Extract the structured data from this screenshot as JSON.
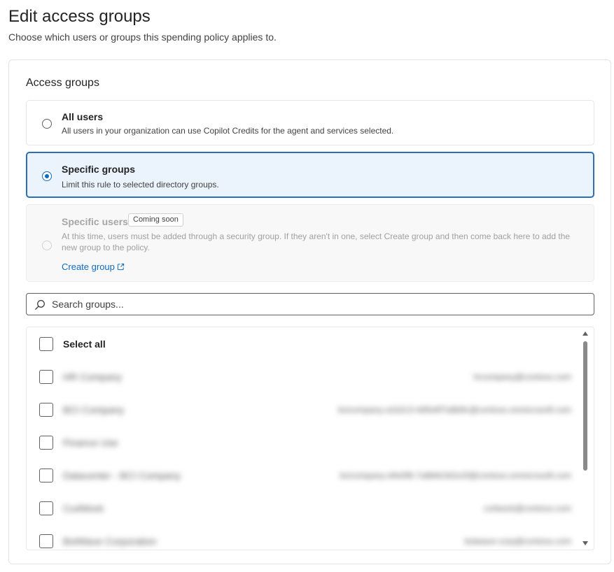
{
  "header": {
    "title": "Edit access groups",
    "subtitle": "Choose which users or groups this spending policy applies to."
  },
  "section": {
    "title": "Access groups"
  },
  "options": {
    "all_users": {
      "title": "All users",
      "description": "All users in your organization can use Copilot Credits for the agent and services selected.",
      "selected": false
    },
    "specific_groups": {
      "title": "Specific groups",
      "description": "Limit this rule to selected directory groups.",
      "selected": true
    },
    "specific_users": {
      "title": "Specific users",
      "badge": "Coming soon",
      "description": "At this time, users must be added through a security group. If they aren't in one, select Create group and then come back here to add the new group to the policy.",
      "link_label": "Create group",
      "disabled": true
    }
  },
  "search": {
    "placeholder": "Search groups..."
  },
  "list": {
    "select_all_label": "Select all",
    "rows": [
      {
        "name": "HR Company",
        "detail": "hrcompany@contoso.com"
      },
      {
        "name": "BCI Company",
        "detail": "bcicompany-a1b2c3-4d5e6f7a8b9c@contoso.onmicrosoft.com"
      },
      {
        "name": "Finance Use",
        "detail": ""
      },
      {
        "name": "Datacenter - BCI Company",
        "detail": "bcicompany-d4e5f6-7a8b9c0d1e2f@contoso.onmicrosoft.com"
      },
      {
        "name": "Co4Work",
        "detail": "co4work@contoso.com"
      },
      {
        "name": "BotWave Corporation",
        "detail": "botwave-corp@contoso.com"
      }
    ]
  },
  "colors": {
    "accent": "#0f6cbd",
    "selected_bg": "#ebf3fc",
    "selected_border": "#2f6db5"
  }
}
